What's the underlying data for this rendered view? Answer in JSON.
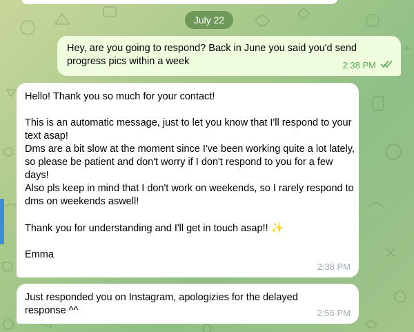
{
  "date_separator": "July 22",
  "colors": {
    "outgoing_bubble": "#effdde",
    "incoming_bubble": "#ffffff",
    "date_pill": "#5e8a4c",
    "read_check": "#57a957"
  },
  "messages": [
    {
      "direction": "outgoing",
      "text": "Hey, are you going to respond? Back in June you said you'd send progress pics within a week",
      "time": "2:38 PM",
      "status_icon": "double-check-icon"
    },
    {
      "direction": "incoming",
      "lines": [
        "Hello! Thank you so much for your contact!",
        "",
        "This is an automatic message, just to let you know that I'll respond to your text asap!",
        "Dms are a bit slow at the moment since I've been working quite a lot lately, so please be patient and don't worry if I don't respond to you for a few days!",
        "Also pls keep in mind that I don't work on weekends, so I rarely respond to dms on weekends aswell!",
        "",
        "Thank you for understanding and I'll get in touch asap!!",
        "",
        "Emma"
      ],
      "emoji_icon": "sparkles-icon",
      "time": "2:38 PM"
    },
    {
      "direction": "incoming",
      "text": "Just responded you on Instagram, apologizies for the delayed response ^^",
      "time": "2:56 PM"
    }
  ]
}
